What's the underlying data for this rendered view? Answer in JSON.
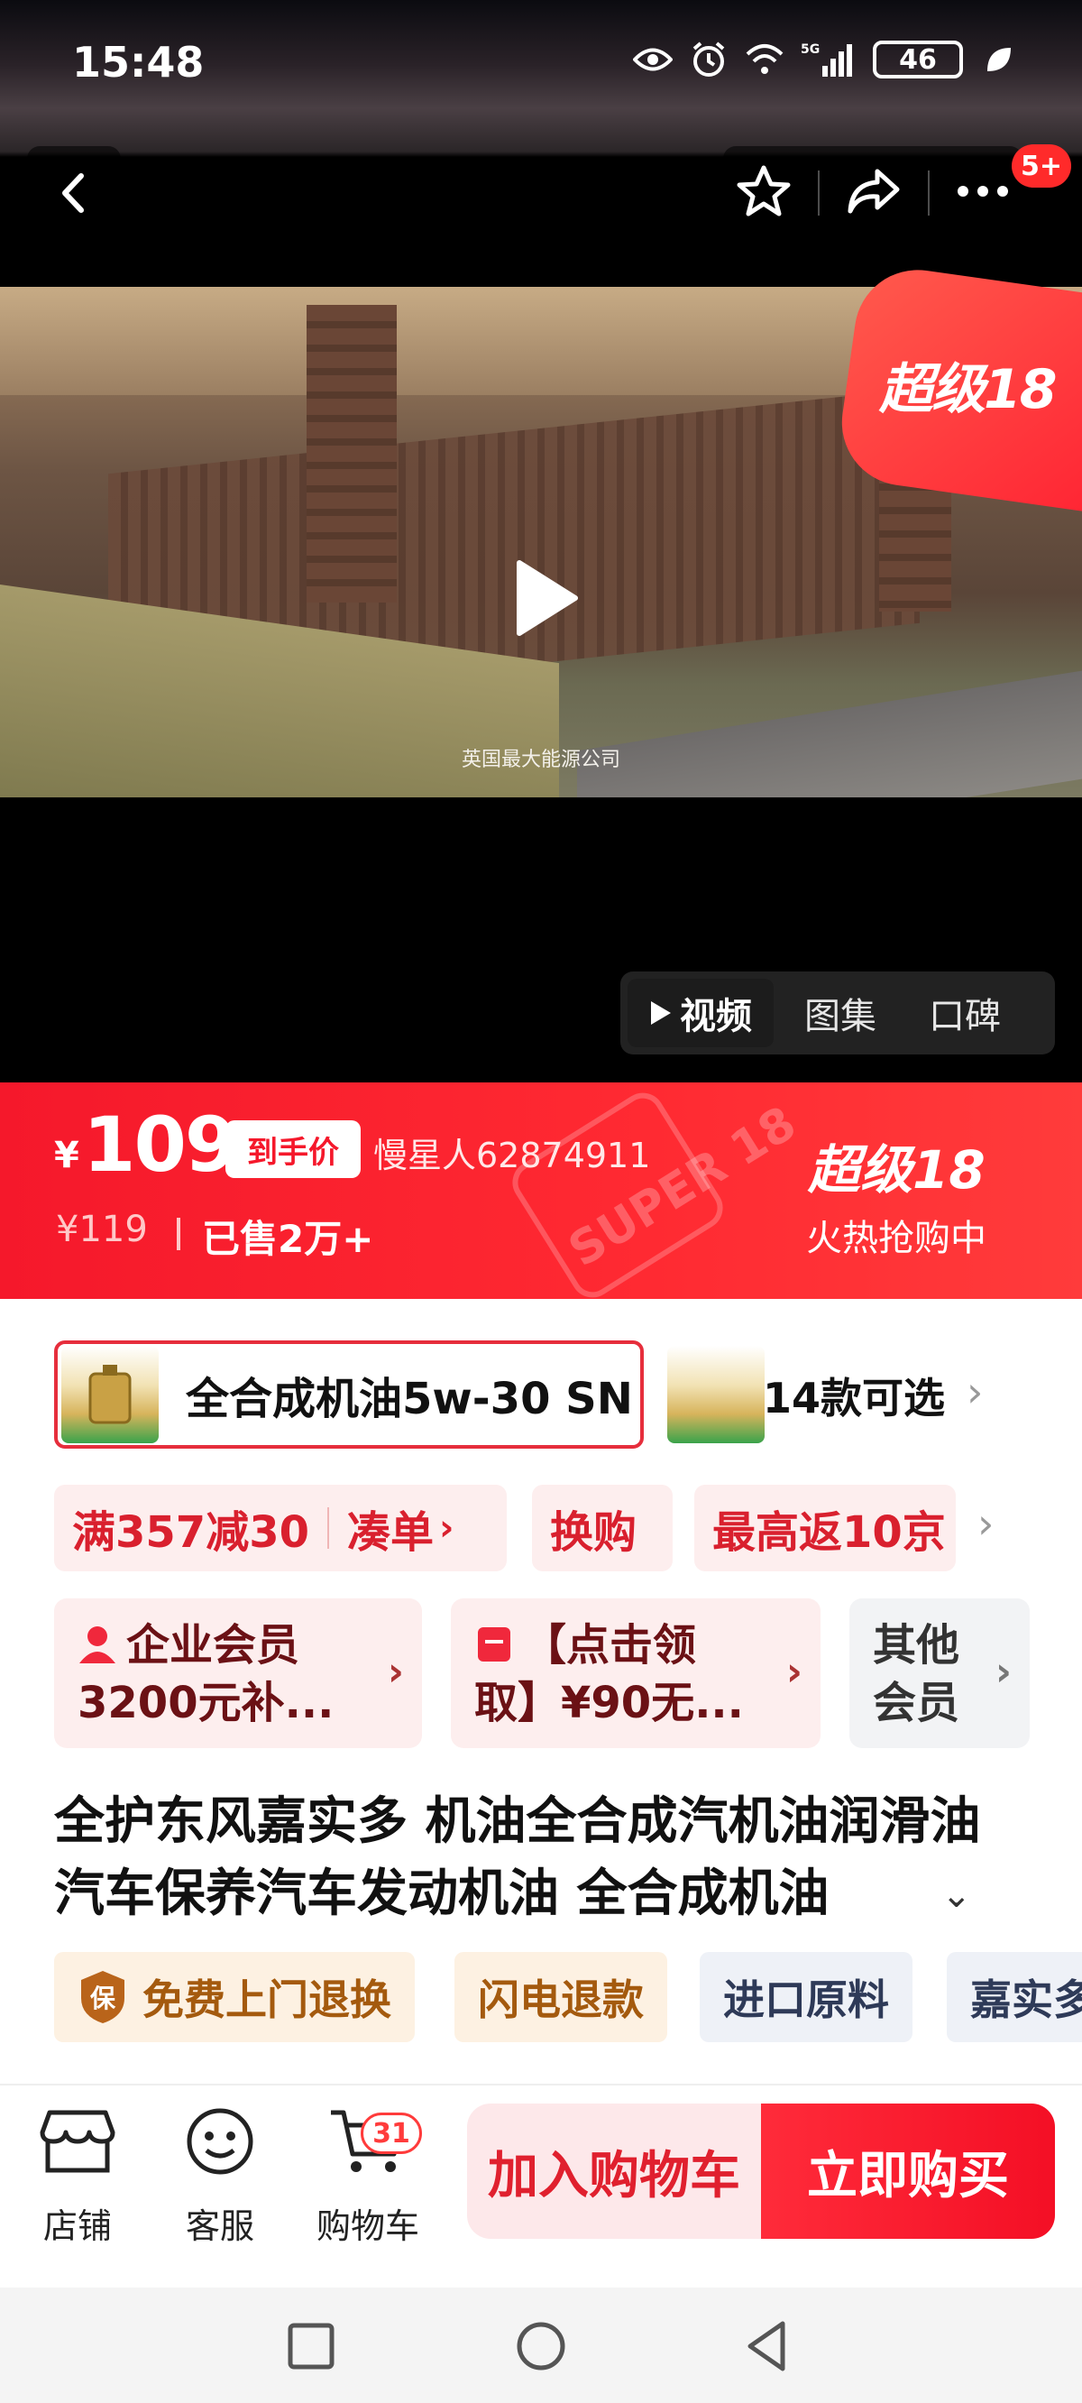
{
  "status_bar": {
    "time": "15:48",
    "network": "5G",
    "battery": "46"
  },
  "nav": {
    "cart_badge": "5+"
  },
  "media": {
    "caption": "英国最大能源公司",
    "promo_ribbon": "超级18",
    "tabs": [
      {
        "label": "视频",
        "active": true
      },
      {
        "label": "图集",
        "active": false
      },
      {
        "label": "口碑",
        "active": false
      }
    ]
  },
  "price": {
    "currency": "¥",
    "amount": "109",
    "tag": "到手价",
    "buyer": "慢星人62874911",
    "original": "¥119",
    "sold": "已售2万+",
    "watermark": "SUPER 18",
    "promo_name": "超级18",
    "promo_sub": "火热抢购中"
  },
  "sku": {
    "selected": "全合成机油5w-30 SN",
    "more": "14款可选"
  },
  "promos": {
    "items": [
      "满357减30",
      "凑单",
      "换购",
      "最高返10京"
    ]
  },
  "members": [
    {
      "line1": "企业会员",
      "line2": "3200元补..."
    },
    {
      "line1": "【点击领",
      "line2": "取】¥90无..."
    },
    {
      "line1": "其他",
      "line2": "会员"
    }
  ],
  "title": "全护东风嘉实多 机油全合成汽机油润滑油汽车保养汽车发动机油 全合成机油",
  "services": [
    {
      "label": "免费上门退换",
      "icon_text": "保"
    },
    {
      "label": "闪电退款"
    },
    {
      "label": "进口原料"
    },
    {
      "label": "嘉实多"
    }
  ],
  "action_bar": {
    "shop": "店铺",
    "service": "客服",
    "cart": "购物车",
    "cart_count": "31",
    "add_to_cart": "加入购物车",
    "buy_now": "立即购买"
  },
  "colors": {
    "primary_red": "#f5182b",
    "chip_bg": "#fdeeee",
    "warm_tag": "#a45a0e"
  }
}
